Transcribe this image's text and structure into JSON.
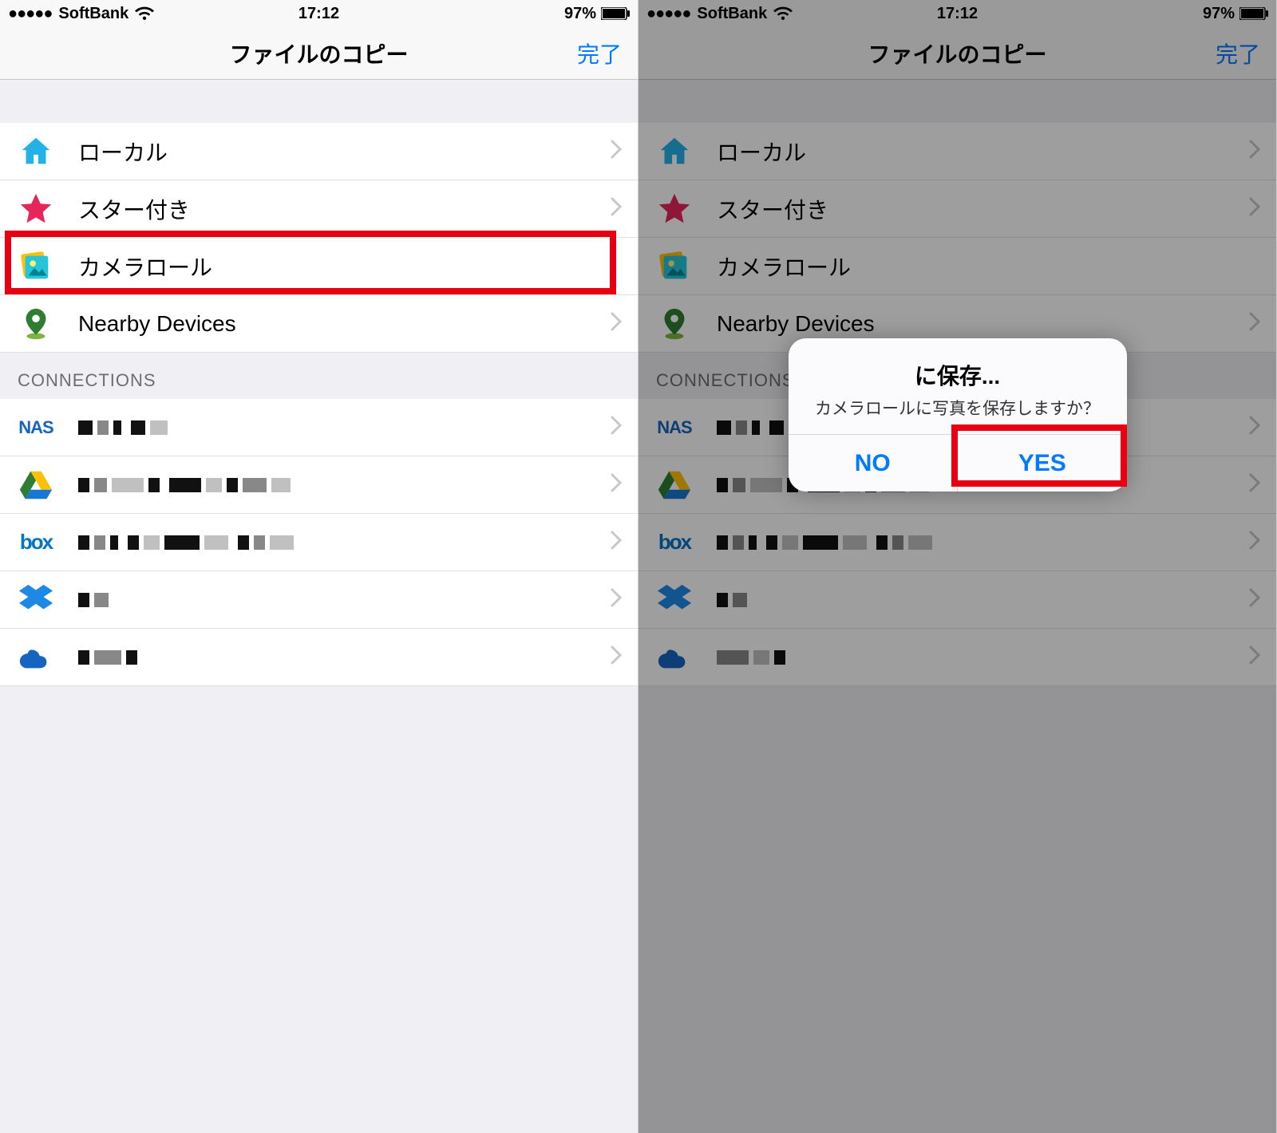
{
  "status": {
    "carrier": "SoftBank",
    "time": "17:12",
    "battery": "97%"
  },
  "nav": {
    "title": "ファイルのコピー",
    "done": "完了"
  },
  "locations": [
    {
      "label": "ローカル",
      "icon": "home"
    },
    {
      "label": "スター付き",
      "icon": "star"
    },
    {
      "label": "カメラロール",
      "icon": "photos"
    },
    {
      "label": "Nearby Devices",
      "icon": "pin"
    }
  ],
  "sectionHeader": "CONNECTIONS",
  "connections": [
    {
      "icon": "nas"
    },
    {
      "icon": "gdrive"
    },
    {
      "icon": "box"
    },
    {
      "icon": "dropbox"
    },
    {
      "icon": "onedrive"
    }
  ],
  "alert": {
    "title": "に保存...",
    "message": "カメラロールに写真を保存しますか？",
    "no": "NO",
    "yes": "YES"
  }
}
